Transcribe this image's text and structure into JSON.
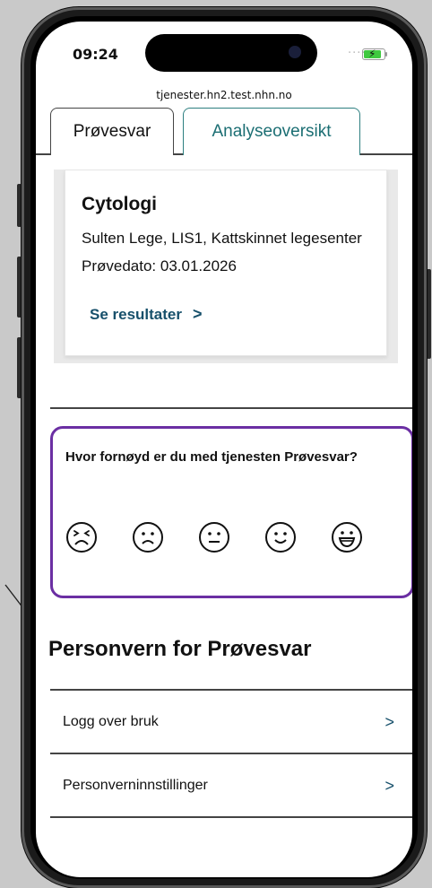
{
  "status_bar": {
    "time": "09:24",
    "signal": "...."
  },
  "browser": {
    "url": "tjenester.hn2.test.nhn.no"
  },
  "tabs": [
    {
      "label": "Prøvesvar",
      "active": true
    },
    {
      "label": "Analyseoversikt",
      "active": false
    }
  ],
  "card": {
    "title": "Cytologi",
    "line1": "Sulten Lege, LIS1, Kattskinnet legesenter",
    "line2": "Prøvedato: 03.01.2026",
    "link_label": "Se resultater",
    "link_chevron": ">"
  },
  "feedback": {
    "question": "Hvor fornøyd er du med tjenesten Prøvesvar?",
    "faces": [
      "very-dissatisfied-face-icon",
      "dissatisfied-face-icon",
      "neutral-face-icon",
      "satisfied-face-icon",
      "very-satisfied-face-icon"
    ],
    "border_color": "#6b2fa3"
  },
  "privacy": {
    "title": "Personvern for Prøvesvar",
    "items": [
      {
        "label": "Logg over bruk",
        "chevron": ">"
      },
      {
        "label": "Personverninnstillinger",
        "chevron": ">"
      }
    ]
  },
  "colors": {
    "accent": "#17506b",
    "tab_accent": "#1b6e73",
    "feedback_border": "#6b2fa3"
  }
}
